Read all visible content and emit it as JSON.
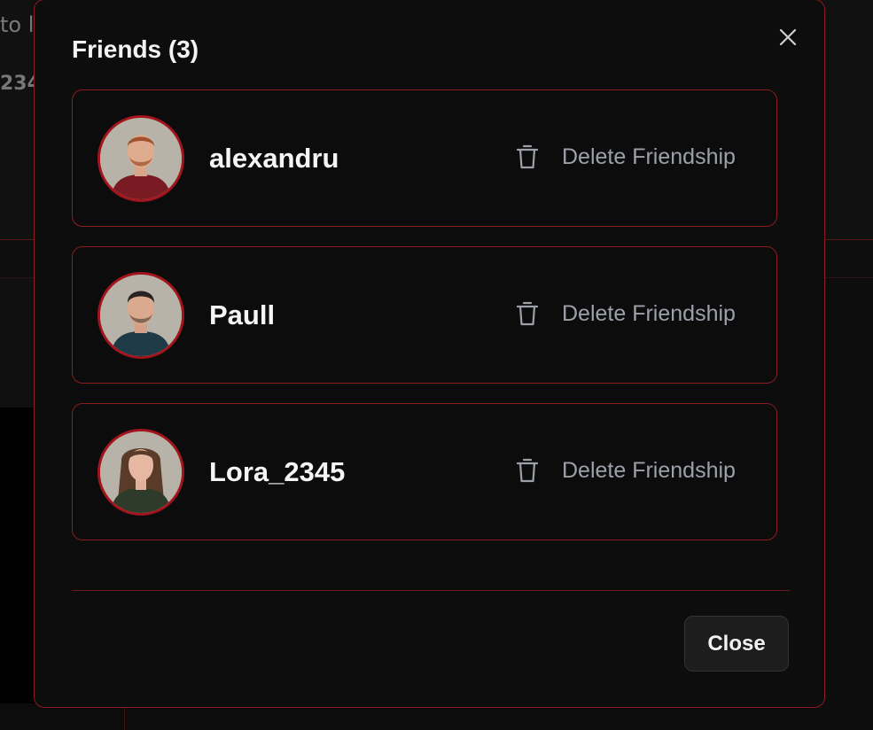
{
  "background": {
    "text_line_1": "to l",
    "text_line_2": "234"
  },
  "modal": {
    "title": "Friends (3)",
    "close_icon": "close-icon",
    "close_button_label": "Close",
    "accent_color": "#8a1c22"
  },
  "friends": [
    {
      "name": "alexandru",
      "delete_label": "Delete Friendship",
      "avatar_icon": "avatar",
      "shirt_color": "#7a1a22",
      "hair_color": "#a0522d"
    },
    {
      "name": "Paull",
      "delete_label": "Delete Friendship",
      "avatar_icon": "avatar",
      "shirt_color": "#1e3a46",
      "hair_color": "#2a2420"
    },
    {
      "name": "Lora_2345",
      "delete_label": "Delete Friendship",
      "avatar_icon": "avatar",
      "shirt_color": "#2e3a2a",
      "hair_color": "#5a3a28"
    }
  ]
}
